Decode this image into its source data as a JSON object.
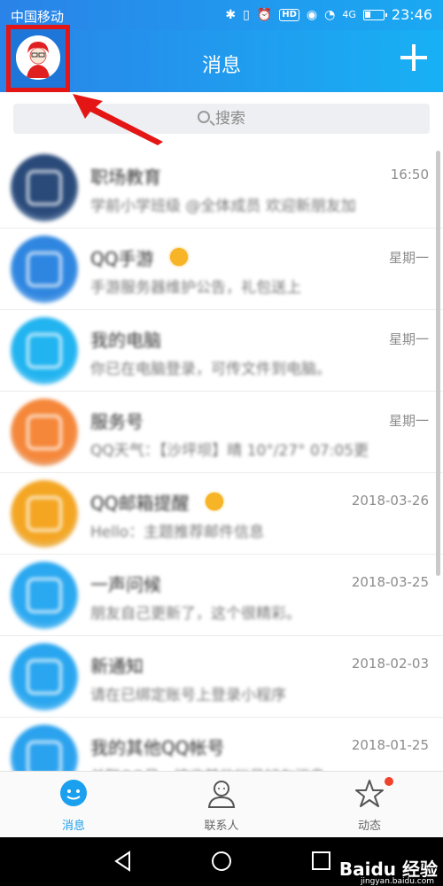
{
  "status_bar": {
    "carrier": "中国移动",
    "hd": "HD",
    "network": "4G",
    "time": "23:46"
  },
  "header": {
    "title": "消息"
  },
  "search": {
    "placeholder": "搜索"
  },
  "conversations": [
    {
      "name": "职场教育",
      "preview": "学前小学班级 @全体成员 欢迎新朋友加",
      "preview_tail": "新朋友加…",
      "time": "16:50",
      "color": "#2a4a7a",
      "badge": false
    },
    {
      "name": "QQ手游",
      "preview": "手游服务器维护公告，礼包送上",
      "preview_tail": "",
      "time": "星期一",
      "color": "#2f86e0",
      "badge": true
    },
    {
      "name": "我的电脑",
      "preview": "你已在电脑登录，可传文件到电脑。",
      "preview_tail": "脑。",
      "time": "星期一",
      "color": "#21b4f0",
      "badge": false
    },
    {
      "name": "服务号",
      "preview": "QQ天气：【沙坪坝】晴 10°/27° 07:05更",
      "preview_tail": "07:05更…",
      "time": "星期一",
      "color": "#f5873a",
      "badge": false
    },
    {
      "name": "QQ邮箱提醒",
      "preview": "Hello：主题推荐邮件信息",
      "preview_tail": "",
      "time": "2018-03-26",
      "color": "#f4a623",
      "badge": true
    },
    {
      "name": "一声问候",
      "preview": "朋友自己更新了，这个很精彩。",
      "preview_tail": "。",
      "time": "2018-03-25",
      "color": "#2aa8f0",
      "badge": false
    },
    {
      "name": "新通知",
      "preview": "请在已绑定账号上登录小程序",
      "preview_tail": "",
      "time": "2018-02-03",
      "color": "#29a6ef",
      "badge": false
    },
    {
      "name": "我的其他QQ帐号",
      "preview": "关联QQ号，接收其他帐号好友消息",
      "preview_tail": "",
      "time": "2018-01-25",
      "color": "#2ba2ee",
      "badge": false
    }
  ],
  "tabs": [
    {
      "label": "消息",
      "icon": "chat-bubble-icon",
      "active": true
    },
    {
      "label": "联系人",
      "icon": "contact-person-icon",
      "active": false
    },
    {
      "label": "动态",
      "icon": "star-icon",
      "active": false
    }
  ],
  "watermark": {
    "brand": "Baidu 经验",
    "url": "jingyan.baidu.com"
  },
  "colors": {
    "accent": "#1aa0ee",
    "header_start": "#2a83e8",
    "header_end": "#18b1f4",
    "highlight": "#e41515"
  }
}
